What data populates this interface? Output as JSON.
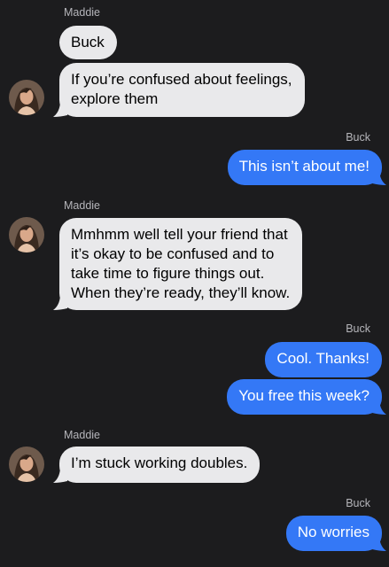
{
  "conversation": {
    "messages": [
      {
        "sender": "Maddie",
        "text": "Buck"
      },
      {
        "sender": "Maddie",
        "lines": [
          "If you’re confused about feelings,",
          "explore them"
        ]
      },
      {
        "sender": "Buck",
        "text": "This isn’t about me!"
      },
      {
        "sender": "Maddie",
        "lines": [
          "Mmhmm well tell your friend that",
          "it’s okay to be confused and to",
          "take time to figure things out.",
          "When they’re ready, they’ll know."
        ]
      },
      {
        "sender": "Buck",
        "text": "Cool. Thanks!"
      },
      {
        "sender": "Buck",
        "text": "You free this week?"
      },
      {
        "sender": "Maddie",
        "text": "I’m stuck working doubles."
      },
      {
        "sender": "Buck",
        "text": "No worries"
      }
    ]
  },
  "colors": {
    "background": "#1c1c1e",
    "incoming_bubble": "#e9e9eb",
    "outgoing_bubble": "#3478f6",
    "sender_label": "#b5b5ba"
  },
  "icons": {
    "contact_avatar": "avatar"
  }
}
